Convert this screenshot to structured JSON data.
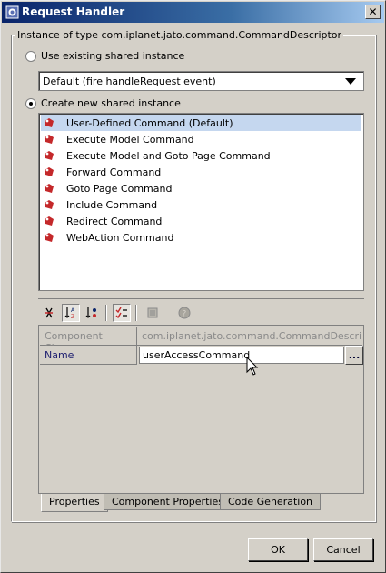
{
  "window": {
    "title": "Request Handler",
    "close_glyph": "✕"
  },
  "group": {
    "label": "Instance of type com.iplanet.jato.command.CommandDescriptor"
  },
  "options": {
    "use_existing_label": "Use existing shared instance",
    "use_existing_checked": false,
    "existing_selected": "Default (fire handleRequest event)",
    "create_new_label": "Create new shared instance",
    "create_new_checked": true
  },
  "commands": [
    {
      "label": "User-Defined Command (Default)",
      "selected": true
    },
    {
      "label": "Execute Model Command",
      "selected": false
    },
    {
      "label": "Execute Model and Goto Page Command",
      "selected": false
    },
    {
      "label": "Forward Command",
      "selected": false
    },
    {
      "label": "Goto Page Command",
      "selected": false
    },
    {
      "label": "Include Command",
      "selected": false
    },
    {
      "label": "Redirect Command",
      "selected": false
    },
    {
      "label": "WebAction Command",
      "selected": false
    }
  ],
  "toolbar_icons": [
    "unsorted-icon",
    "sort-by-name-icon",
    "sort-by-type-icon",
    "display-editable-icon",
    "customizer-icon",
    "help-icon"
  ],
  "properties": [
    {
      "name": "Component Class",
      "value": "com.iplanet.jato.command.CommandDescriptor",
      "enabled": false
    },
    {
      "name": "Name",
      "value": "userAccessCommand",
      "enabled": true
    }
  ],
  "ellipsis_label": "...",
  "tabs": [
    {
      "label": "Properties",
      "active": true
    },
    {
      "label": "Component Properties",
      "active": false
    },
    {
      "label": "Code Generation",
      "active": false
    }
  ],
  "buttons": {
    "ok": "OK",
    "cancel": "Cancel"
  },
  "colors": {
    "title_start": "#0a246a",
    "title_end": "#a6caf0",
    "selection": "#c5d7ef",
    "command_icon": "#c4282a"
  }
}
